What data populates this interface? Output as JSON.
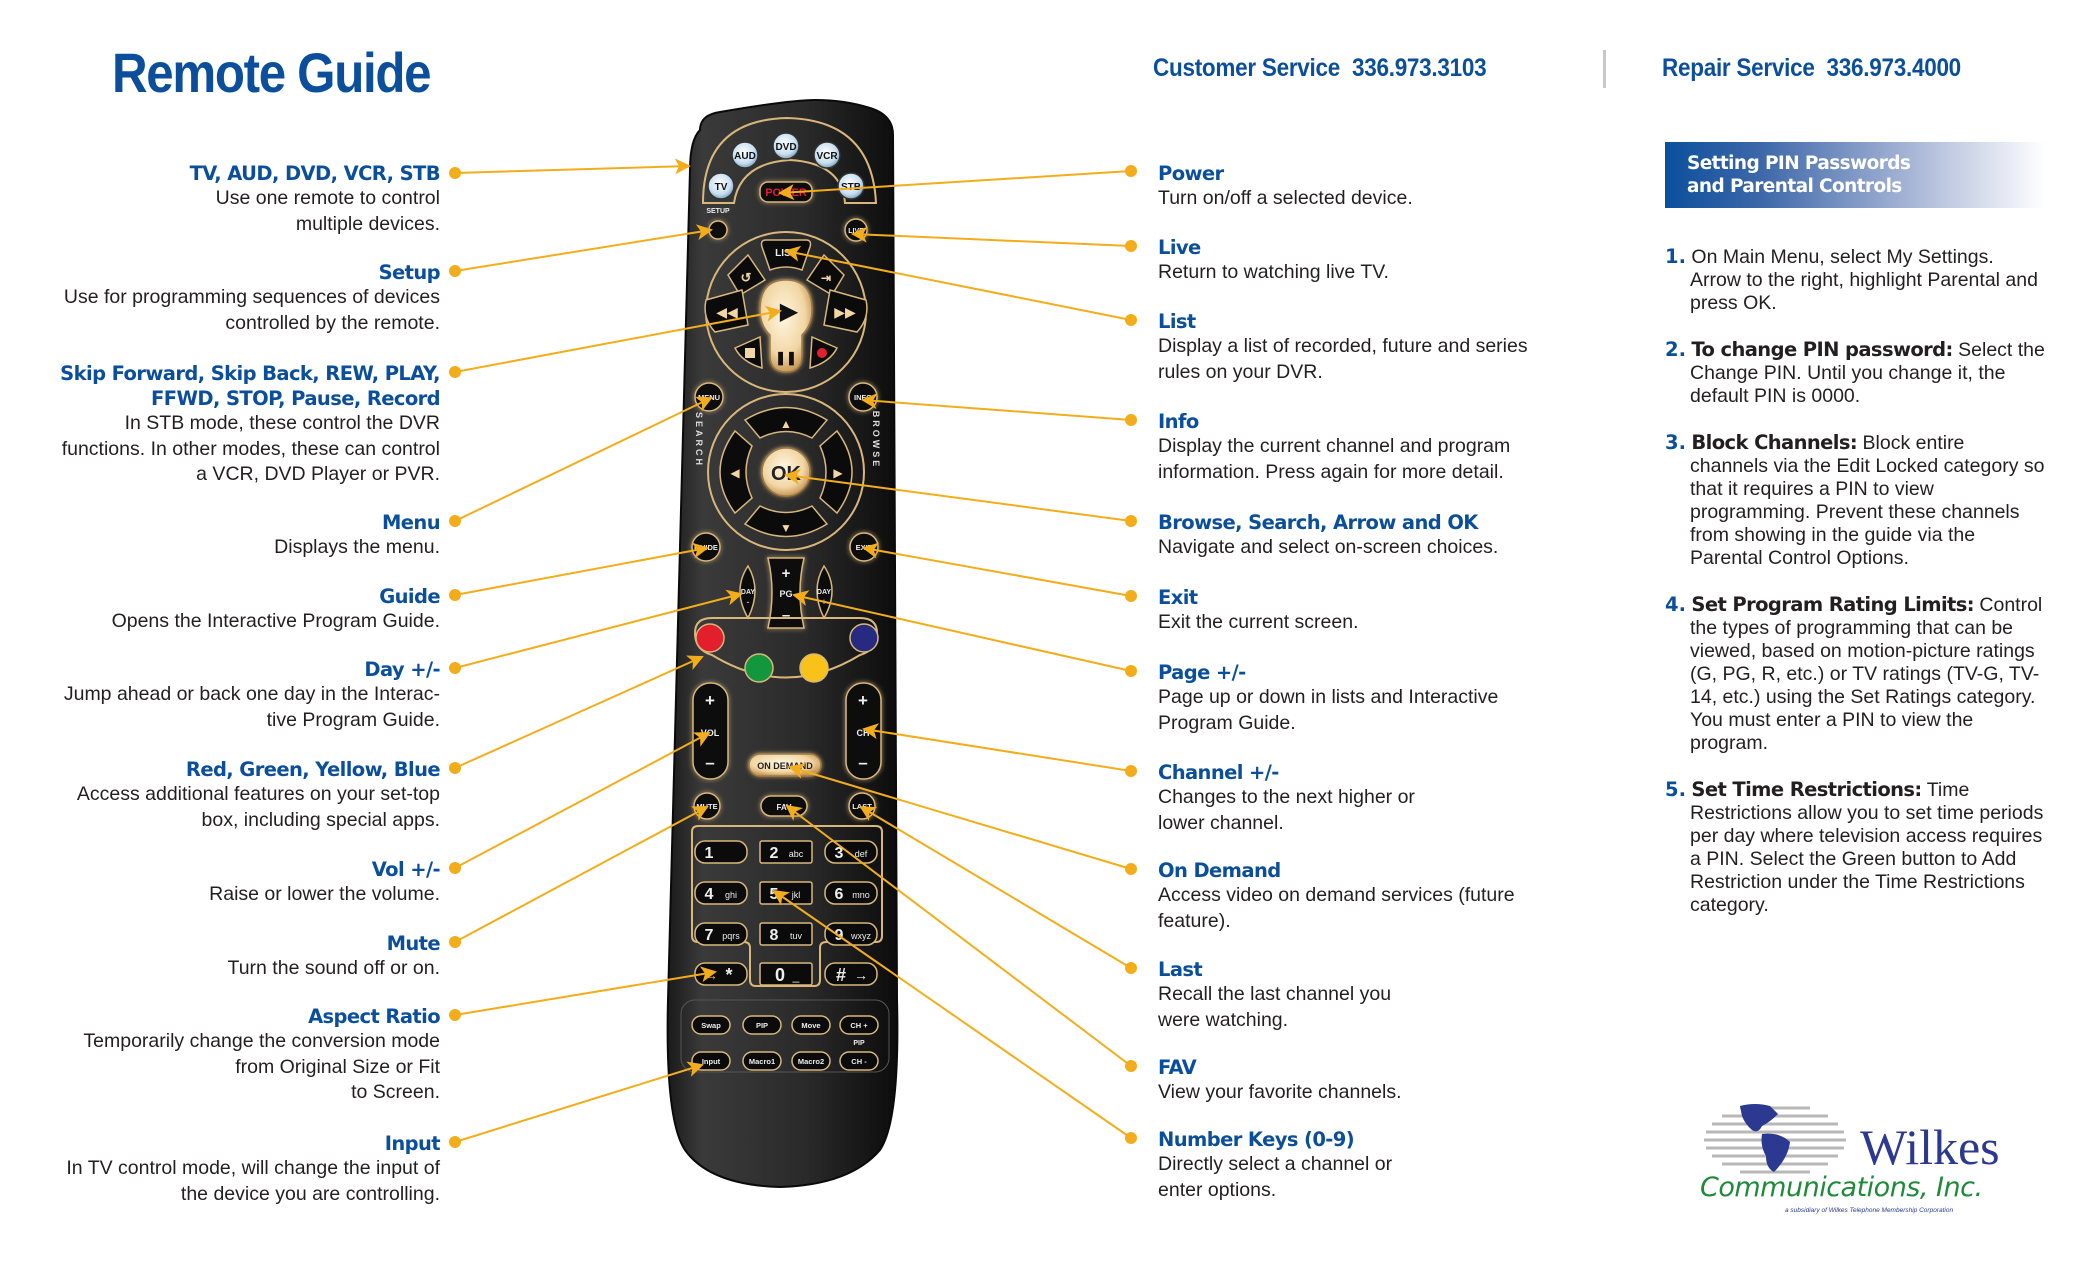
{
  "header": {
    "title": "Remote Guide",
    "customer_service": "Customer Service  336.973.3103",
    "repair_service": "Repair Service  336.973.4000"
  },
  "left_labels": [
    {
      "title": "TV, AUD, DVD, VCR, STB",
      "lines": [
        "Use one remote to control",
        "multiple devices."
      ]
    },
    {
      "title": "Setup",
      "lines": [
        "Use for programming sequences of devices",
        "controlled by the remote."
      ]
    },
    {
      "title": "Skip Forward, Skip Back, REW, PLAY,",
      "title2": "FFWD, STOP, Pause, Record",
      "lines": [
        "In STB mode, these control the DVR",
        "functions. In other modes, these can control",
        "a VCR, DVD Player or PVR."
      ]
    },
    {
      "title": "Menu",
      "lines": [
        "Displays the menu."
      ]
    },
    {
      "title": "Guide",
      "lines": [
        "Opens the Interactive Program Guide."
      ]
    },
    {
      "title": "Day +/-",
      "lines": [
        "Jump ahead or back one day in the Interac-",
        "tive Program Guide."
      ]
    },
    {
      "title": "Red, Green, Yellow, Blue",
      "lines": [
        "Access additional features on your set-top",
        "box, including special apps."
      ]
    },
    {
      "title": "Vol +/-",
      "lines": [
        "Raise or lower the volume."
      ]
    },
    {
      "title": "Mute",
      "lines": [
        "Turn the sound off or on."
      ]
    },
    {
      "title": "Aspect Ratio",
      "lines": [
        "Temporarily change the conversion mode",
        "from Original Size or Fit",
        "to Screen."
      ]
    },
    {
      "title": "Input",
      "lines": [
        "In TV control mode, will change the input of",
        "the device you are controlling."
      ]
    }
  ],
  "right_labels": [
    {
      "title": "Power",
      "lines": [
        "Turn on/off a selected device."
      ]
    },
    {
      "title": "Live",
      "lines": [
        "Return to watching live TV."
      ]
    },
    {
      "title": "List",
      "lines": [
        "Display a list of recorded, future and series",
        "rules on your DVR."
      ]
    },
    {
      "title": "Info",
      "lines": [
        "Display the current channel and program",
        "information. Press again for more detail."
      ]
    },
    {
      "title": "Browse, Search, Arrow and OK",
      "lines": [
        "Navigate and select on-screen choices."
      ]
    },
    {
      "title": "Exit",
      "lines": [
        "Exit the current screen."
      ]
    },
    {
      "title": "Page +/-",
      "lines": [
        "Page up or down in lists and Interactive",
        "Program Guide."
      ]
    },
    {
      "title": "Channel +/-",
      "lines": [
        "Changes to the next higher or",
        "lower channel."
      ]
    },
    {
      "title": "On Demand",
      "lines": [
        "Access video on demand services (future",
        "feature)."
      ]
    },
    {
      "title": "Last",
      "lines": [
        "Recall the last channel you",
        "were watching."
      ]
    },
    {
      "title": "FAV",
      "lines": [
        "View your favorite channels."
      ]
    },
    {
      "title": "Number Keys (0-9)",
      "lines": [
        "Directly select a channel or",
        "enter options."
      ]
    }
  ],
  "pin_panel": {
    "heading_line1": "Setting PIN Passwords",
    "heading_line2": "and Parental Controls",
    "items": [
      {
        "num": "1.",
        "bold": "",
        "text": "On Main Menu, select My Settings. Arrow to the right, highlight Parental and press OK."
      },
      {
        "num": "2.",
        "bold": "To change PIN password:",
        "text": " Select the Change PIN. Until you change it, the default PIN is 0000."
      },
      {
        "num": "3.",
        "bold": "Block Channels:",
        "text": " Block entire channels via the Edit Locked category so that it requires a PIN to view programming. Prevent these channels from showing in the guide via the Parental Control Options."
      },
      {
        "num": "4.",
        "bold": "Set Program Rating Limits:",
        "text": " Control the types of programming that can be viewed, based on motion-picture ratings (G, PG, R, etc.) or TV ratings (TV-G, TV-14, etc.) using the Set Ratings category. You must enter a PIN to view the program."
      },
      {
        "num": "5.",
        "bold": "Set Time Restrictions:",
        "text": " Time Restrictions allow you to set time periods per day where television access requires a PIN. Select the Green button to Add Restriction under the Time Restrictions category."
      }
    ]
  },
  "logo": {
    "name": "Wilkes",
    "line2": "Communications, Inc.",
    "tagline": "a subsidiary of Wilkes Telephone Membership Corporation"
  },
  "remote": {
    "device_buttons": [
      "AUD",
      "DVD",
      "VCR",
      "TV",
      "STB"
    ],
    "power": "POWER",
    "setup": "SETUP",
    "live": "LIVE",
    "list": "LIST",
    "menu": "MENU",
    "info": "INFO",
    "ok": "OK",
    "search": "SEARCH",
    "browse": "BROWSE",
    "guide": "GUIDE",
    "exit": "EXIT",
    "day_minus": "DAY",
    "day_plus": "DAY",
    "page": "PG",
    "vol": "VOL",
    "ch": "CH",
    "on_demand": "ON DEMAND",
    "mute": "MUTE",
    "fav": "FAV",
    "last": "LAST",
    "keys": [
      {
        "num": "1",
        "letters": ""
      },
      {
        "num": "2",
        "letters": "abc"
      },
      {
        "num": "3",
        "letters": "def"
      },
      {
        "num": "4",
        "letters": "ghi"
      },
      {
        "num": "5",
        "letters": "jkl"
      },
      {
        "num": "6",
        "letters": "mno"
      },
      {
        "num": "7",
        "letters": "pqrs"
      },
      {
        "num": "8",
        "letters": "tuv"
      },
      {
        "num": "9",
        "letters": "wxyz"
      }
    ],
    "star": "*",
    "zero": "0",
    "hash": "#",
    "bottom_row1": [
      "Swap",
      "PIP",
      "Move",
      "CH +"
    ],
    "pip_label": "PIP",
    "bottom_row2": [
      "Input",
      "Macro1",
      "Macro2",
      "CH -"
    ],
    "colors": {
      "red": "#e31e2d",
      "green": "#12973f",
      "yellow": "#f9c21a",
      "blue": "#262a80"
    }
  },
  "colors": {
    "brand_blue": "#0b4f9c",
    "callout": "#f3ad1b",
    "remote_body": "#2d2d2d",
    "gold_trim": "#d9b77a"
  }
}
